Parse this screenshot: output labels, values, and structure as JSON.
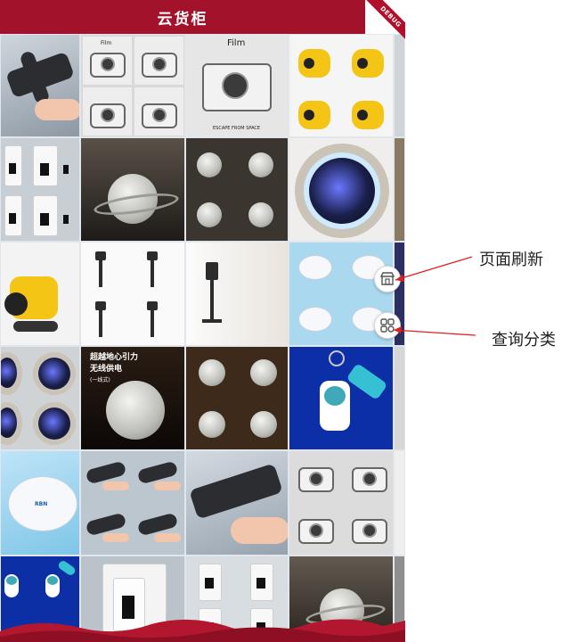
{
  "header": {
    "title": "云货柜"
  },
  "debug_banner": "DEBUG",
  "tiles": {
    "film_text": "Film",
    "film_caption": "ESCAPE FROM SPACE",
    "moon_ad_line1": "超越地心引力",
    "moon_ad_line2": "无线供电",
    "moon_ad_line3": "(一线式)",
    "mouse_brand": "RBN"
  },
  "floating_buttons": {
    "refresh_icon": "shop-icon",
    "category_icon": "grid-icon"
  },
  "annotations": {
    "refresh_label": "页面刷新",
    "category_label": "查询分类"
  },
  "colors": {
    "header_bg": "#a3122b",
    "arrow": "#e02020"
  }
}
